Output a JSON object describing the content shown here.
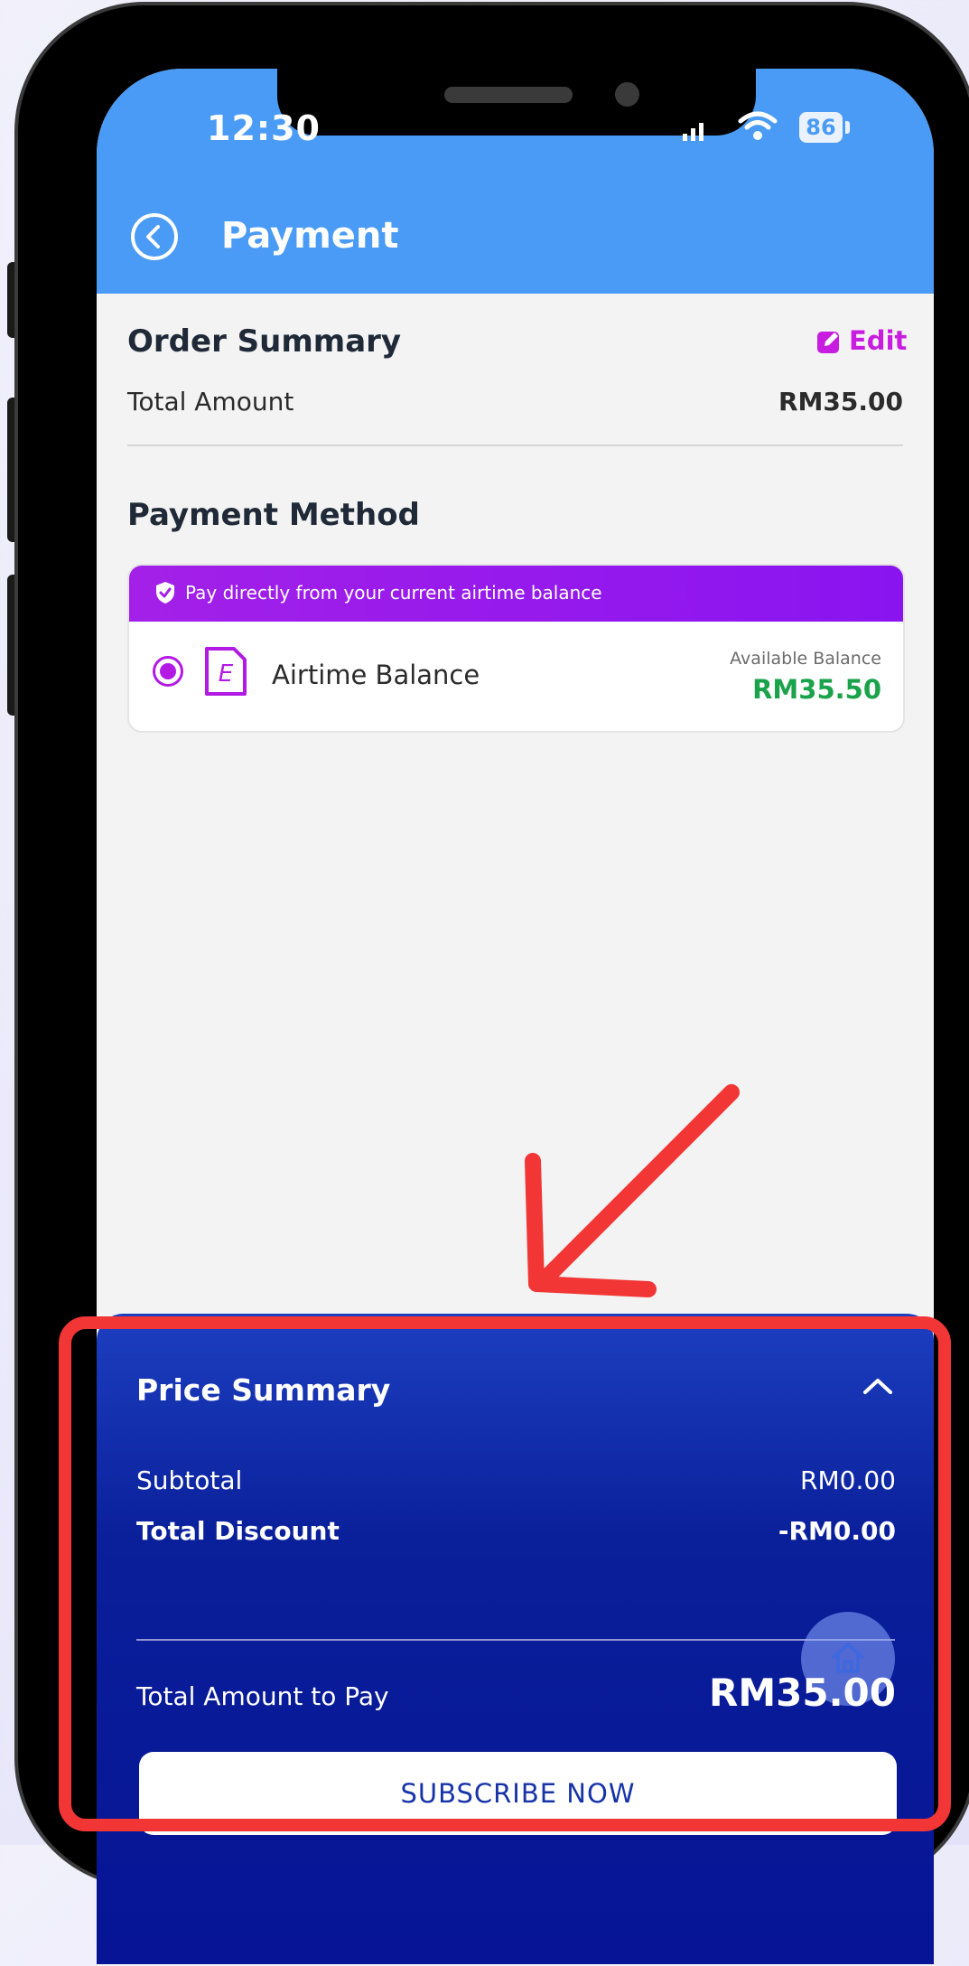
{
  "status_bar": {
    "time": "12:30",
    "battery": "86"
  },
  "header": {
    "title": "Payment"
  },
  "order_summary": {
    "title": "Order Summary",
    "edit_label": "Edit",
    "total_label": "Total Amount",
    "total_value": "RM35.00"
  },
  "payment_method": {
    "title": "Payment Method",
    "banner_text": "Pay directly from your current airtime balance",
    "option": {
      "name": "Airtime Balance",
      "icon_letter": "E",
      "available_label": "Available Balance",
      "available_value": "RM35.50",
      "selected": true
    }
  },
  "price_summary": {
    "title": "Price Summary",
    "subtotal_label": "Subtotal",
    "subtotal_value": "RM0.00",
    "discount_label": "Total Discount",
    "discount_value": "-RM0.00",
    "total_label": "Total Amount to Pay",
    "total_value": "RM35.00",
    "cta_label": "SUBSCRIBE NOW"
  },
  "colors": {
    "header": "#4a9bf5",
    "accent_purple": "#b21ae4",
    "edit": "#c81de0",
    "balance_green": "#1aa34a",
    "panel_blue": "#0a1f9a",
    "annotation_red": "#f23636"
  },
  "icons": [
    "back-icon",
    "wifi-icon",
    "signal-icon",
    "battery-icon",
    "edit-icon",
    "shield-check-icon",
    "sim-card-icon",
    "chevron-up-icon",
    "home-icon",
    "arrow-annotation"
  ]
}
